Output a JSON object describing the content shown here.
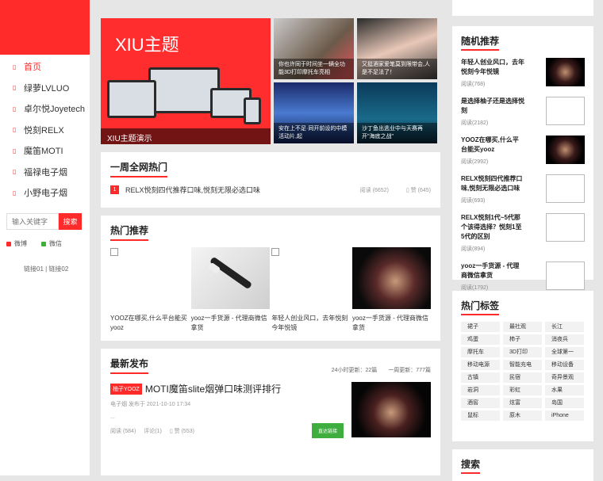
{
  "nav": {
    "items": [
      "首页",
      "绿萝LVLUO",
      "卓尔悦Joyetech",
      "悦刻RELX",
      "魔笛MOTI",
      "福禄电子烟",
      "小野电子烟"
    ]
  },
  "search": {
    "placeholder": "输入关键字",
    "button": "搜索"
  },
  "social": {
    "weibo": "微博",
    "weixin": "微信"
  },
  "links": "链接01 | 链接02",
  "hero": {
    "brand": "XIU主题",
    "caption": "XIU主题演示",
    "thumbs": [
      "你也许同于时间坐一辆全功能3D打印摩托车亮相",
      "又挺酒家爱笔莫到限带会,人是不足法了！",
      "安在上不足·同开前设的中模活动片,起",
      "沙丁鱼出逃业中与天赛再开\"海底之战\""
    ]
  },
  "weekly": {
    "title": "一周全网热门",
    "num": "1",
    "text": "RELX悦刻四代推荐口味,悦刻无限必选口味",
    "reads": "阅读 (6652)",
    "likes": "赞 (645)"
  },
  "hot": {
    "title": "热门推荐",
    "items": [
      "YOOZ在哪买,什么平台能买yooz",
      "yooz一手货源 - 代理商微信拿货",
      "年轻人创业风口，去年悦刻今年悦镜",
      "yooz一手货源 - 代理商微信拿货"
    ]
  },
  "latest": {
    "title": "最新发布",
    "stat1": "24小时更新：22篇",
    "stat2": "一周更新：777篇",
    "tag": "柚子YOOZ",
    "post_title": "MOTI魔笛slite烟弹口味测评排行",
    "post_meta": "电子烟 发布于 2021-10-10 17:34",
    "ellipsis": "...",
    "reads": "阅读 (584)",
    "comments": "评论(1)",
    "likes": "赞 (553)",
    "button": "直达链接"
  },
  "random": {
    "title": "随机推荐",
    "items": [
      {
        "t": "年轻人创业风口，去年悦刻今年悦镜",
        "r": "阅读(768)"
      },
      {
        "t": "是选择柚子还是选择悦刻",
        "r": "阅读(2182)"
      },
      {
        "t": "YOOZ在哪买,什么平台能买yooz",
        "r": "阅读(2992)"
      },
      {
        "t": "RELX悦刻四代推荐口味,悦刻无限必选口味",
        "r": "阅读(693)"
      },
      {
        "t": "RELX悦刻1代~5代那个该得选择？悦刻1至5代的区别",
        "r": "阅读(894)"
      },
      {
        "t": "yooz一手货源 - 代理商微信拿货",
        "r": "阅读(1792)"
      }
    ]
  },
  "tags": {
    "title": "热门标签",
    "items": [
      "裙子",
      "最社观",
      "长江",
      "鸡蛋",
      "柿子",
      "消夜兵",
      "摩托车",
      "3D打印",
      "全球第一",
      "移动电源",
      "智能充电",
      "移动设备",
      "古镇",
      "民宿",
      "奇异景观",
      "岩洞",
      "彩虹",
      "水果",
      "酒窖",
      "炫富",
      "岛国",
      "鼠标",
      "原木",
      "iPhone"
    ]
  },
  "search_box": {
    "title": "搜索"
  },
  "colors": {
    "accent": "#ff2a2a",
    "green": "#3fae3f"
  }
}
